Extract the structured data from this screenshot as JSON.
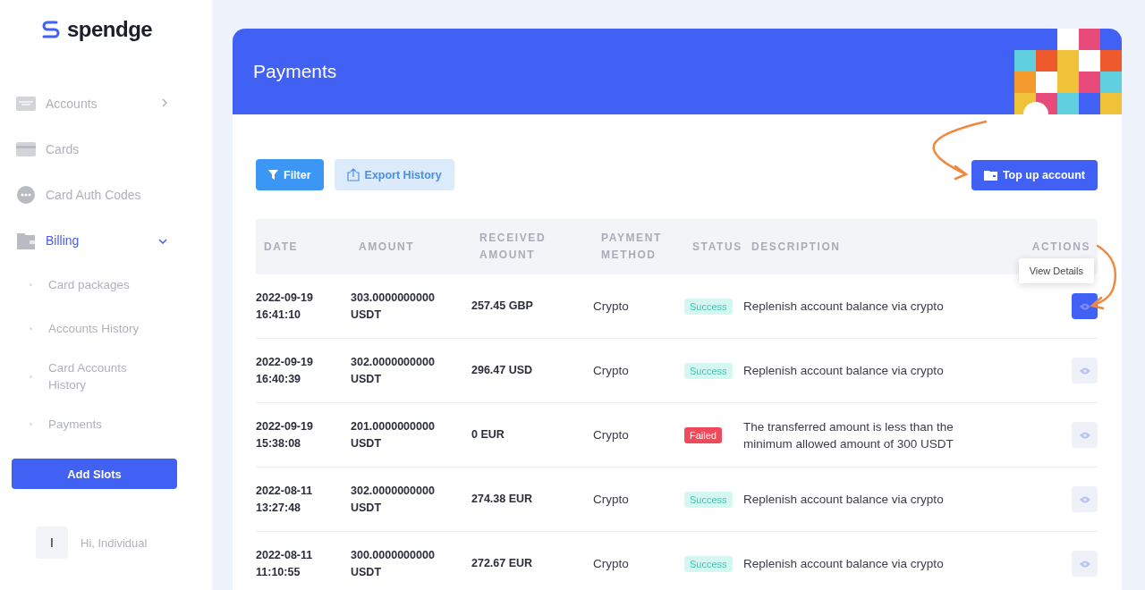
{
  "brand": {
    "name": "spendge"
  },
  "sidebar": {
    "items": [
      {
        "label": "Accounts",
        "selected": false,
        "expanded": false
      },
      {
        "label": "Cards",
        "selected": false
      },
      {
        "label": "Card Auth Codes",
        "selected": false
      },
      {
        "label": "Billing",
        "selected": true,
        "expanded": true,
        "children": [
          {
            "label": "Card packages",
            "selected": false
          },
          {
            "label": "Accounts History",
            "selected": false
          },
          {
            "label": "Card Accounts History",
            "selected": false
          },
          {
            "label": "Payments",
            "selected": false
          }
        ]
      }
    ],
    "button": "Add Slots",
    "user": {
      "initial": "I",
      "greeting": "Hi, Individual"
    }
  },
  "page": {
    "title": "Payments"
  },
  "toolbar": {
    "filter": "Filter",
    "export": "Export History",
    "top_up": "Top up account"
  },
  "table": {
    "columns": [
      "DATE",
      "AMOUNT",
      "RECEIVED AMOUNT",
      "PAYMENT METHOD",
      "STATUS",
      "DESCRIPTION",
      "ACTIONS"
    ],
    "tooltip": "View Details",
    "rows": [
      {
        "date": "2022-09-19",
        "time": "16:41:10",
        "amount": "303.0000000000",
        "currency": "USDT",
        "received": "257.45 GBP",
        "method": "Crypto",
        "status": {
          "text": "Success",
          "kind": "success"
        },
        "description": "Replenish account balance via crypto",
        "selected": true
      },
      {
        "date": "2022-09-19",
        "time": "16:40:39",
        "amount": "302.0000000000",
        "currency": "USDT",
        "received": "296.47 USD",
        "method": "Crypto",
        "status": {
          "text": "Success",
          "kind": "success"
        },
        "description": "Replenish account balance via crypto",
        "selected": false
      },
      {
        "date": "2022-09-19",
        "time": "15:38:08",
        "amount": "201.0000000000",
        "currency": "USDT",
        "received": "0 EUR",
        "method": "Crypto",
        "status": {
          "text": "Failed",
          "kind": "failed"
        },
        "description": "The transferred amount is less than the minimum allowed amount of 300 USDT",
        "selected": false
      },
      {
        "date": "2022-08-11",
        "time": "13:27:48",
        "amount": "302.0000000000",
        "currency": "USDT",
        "received": "274.38 EUR",
        "method": "Crypto",
        "status": {
          "text": "Success",
          "kind": "success"
        },
        "description": "Replenish account balance via crypto",
        "selected": false
      },
      {
        "date": "2022-08-11",
        "time": "11:10:55",
        "amount": "300.0000000000",
        "currency": "USDT",
        "received": "272.67 EUR",
        "method": "Crypto",
        "status": {
          "text": "Success",
          "kind": "success"
        },
        "description": "Replenish account balance via crypto",
        "selected": false
      }
    ]
  }
}
